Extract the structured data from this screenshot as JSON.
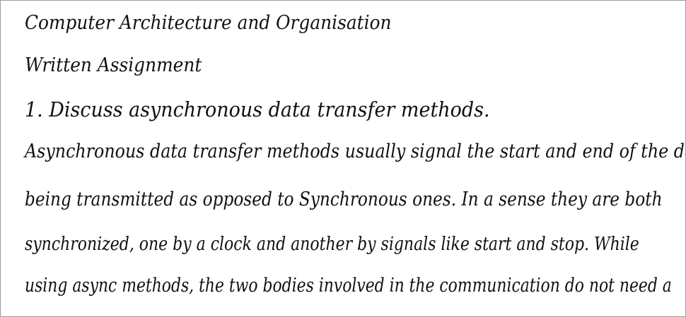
{
  "document": {
    "title": "Computer Architecture and Organisation",
    "subtitle": "Written Assignment",
    "question": "1. Discuss asynchronous data transfer methods.",
    "answer_lines": [
      "Asynchronous data transfer methods usually signal the start and end of the data",
      "being transmitted as opposed to Synchronous ones. In a sense they are both",
      "synchronized, one by a clock and another by signals like start and stop. While",
      "using async methods, the two bodies involved in the communication do not need a"
    ]
  }
}
